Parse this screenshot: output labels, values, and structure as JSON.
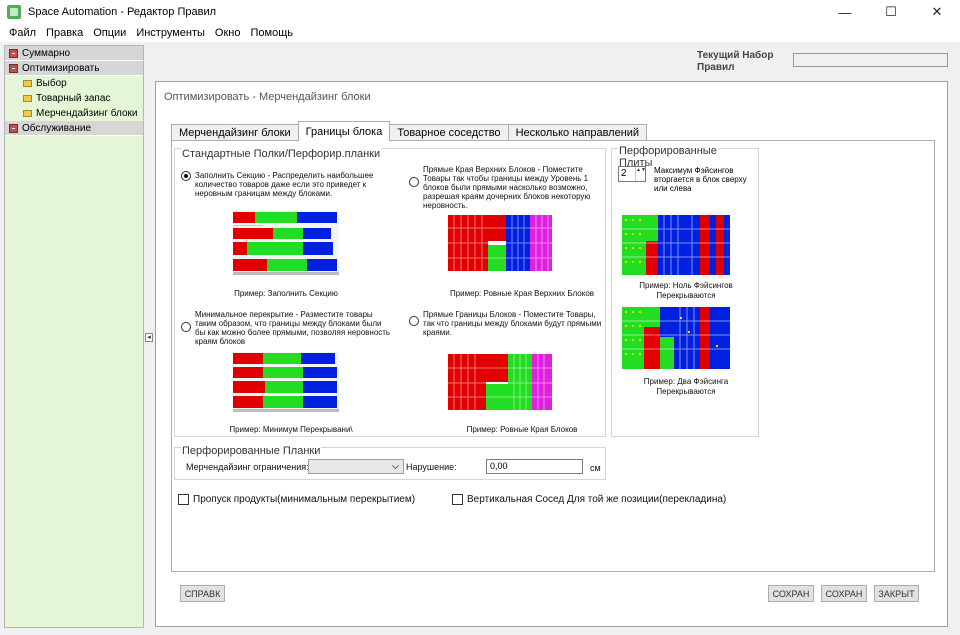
{
  "window": {
    "title": "Space Automation - Редактор Правил",
    "minimize": "—",
    "maximize": "☐",
    "close": "✕"
  },
  "menu": [
    "Файл",
    "Правка",
    "Опции",
    "Инструменты",
    "Окно",
    "Помощь"
  ],
  "sidebar": {
    "groups": [
      {
        "label": "Суммарно",
        "icon": "red-node-icon",
        "children": []
      },
      {
        "label": "Оптимизировать",
        "icon": "red-node-icon",
        "children": [
          "Выбор",
          "Товарный запас",
          "Мерчендайзинг блоки"
        ]
      },
      {
        "label": "Обслуживание",
        "icon": "red-node-icon",
        "children": []
      }
    ],
    "splitter": "◂"
  },
  "header": {
    "rule_set_label": "Текущий Набор Правил",
    "rule_set_value": ""
  },
  "panel": {
    "title": "Оптимизировать - Мерчендайзинг блоки",
    "tabs": [
      "Мерчендайзинг блоки",
      "Границы блока",
      "Товарное соседство",
      "Несколько направлений"
    ],
    "active_tab": 1,
    "shelves_group": {
      "title": "Стандартные Полки/Перфорир.планки",
      "options": [
        {
          "text": "Заполнить Секцию - Распределить наибольшее количество товаров даже если это приведет к неровным границам между блоками.",
          "checked": true,
          "caption": "Пример: Заполнить Секцию"
        },
        {
          "text": "Прямые Края Верхних Блоков - Поместите Товары так чтобы границы между Уровень 1 блоков были прямыми насколько возможно, разрешая краям дочерних блоков некоторую неровность.",
          "checked": false,
          "caption": "Пример: Ровные Края Верхних Блоков"
        },
        {
          "text": "Минимальное перекрытие - Разместите товары таким образом, что границы между блоками были бы как можно более прямыми, позволяя неровность краям блоков",
          "checked": false,
          "caption": "Пример: Минимум Перекрывани\\"
        },
        {
          "text": "Прямые Границы Блоков - Поместите Товары, так что границы между блоками будут прямыми краями.",
          "checked": false,
          "caption": "Пример: Ровные Края Блоков"
        }
      ]
    },
    "pegboard_group": {
      "title": "Перфорированные Плиты",
      "stepper_value": "2",
      "stepper_arrows": "▲▼",
      "note": "Максимум Фэйсингов вторгается в блок сверху или слева",
      "captions": [
        "Пример: Ноль Фэйсингов Перекрываются",
        "Пример: Два Фэйсинга Перекрываются"
      ]
    },
    "perf_strips": {
      "title": "Перфорированные Планки",
      "constraint_label": "Мерчендайзинг ограничения:",
      "constraint_value": "",
      "violation_label": "Нарушение:",
      "violation_value": "0,00",
      "unit": "см"
    },
    "checkboxes": [
      {
        "label": "Пропуск продукты(минимальным перекрытием)",
        "checked": false
      },
      {
        "label": "Вертикальная Сосед Для той же позиции(перекладина)",
        "checked": false
      }
    ],
    "buttons": {
      "help": "СПРАВК",
      "save1": "СОХРАН",
      "save2": "СОХРАН",
      "close": "ЗАКРЫТ"
    }
  },
  "colors": {
    "red": "#e00000",
    "green": "#22dd22",
    "blue": "#0020e0",
    "magenta": "#e020e0",
    "sidebar_bg": "#e4f6d5"
  }
}
